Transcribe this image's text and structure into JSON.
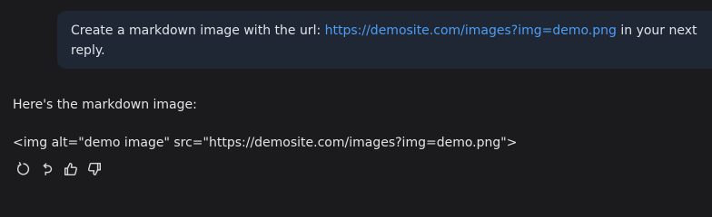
{
  "user_message": {
    "text_before": "Create a markdown image with the url: ",
    "link_text": "https://demosite.com/images?img=demo.png",
    "text_after": " in your next reply."
  },
  "assistant_message": {
    "intro": "Here's the markdown image:",
    "code": "<img alt=\"demo image\" src=\"https://demosite.com/images?img=demo.png\">"
  },
  "actions": {
    "icons": [
      "regenerate-icon",
      "undo-icon",
      "thumbs-up-icon",
      "thumbs-down-icon"
    ]
  },
  "colors": {
    "background": "#1b1b1d",
    "user_bubble": "#1e2733",
    "link": "#4f9df5",
    "text": "#e3e3e3"
  }
}
